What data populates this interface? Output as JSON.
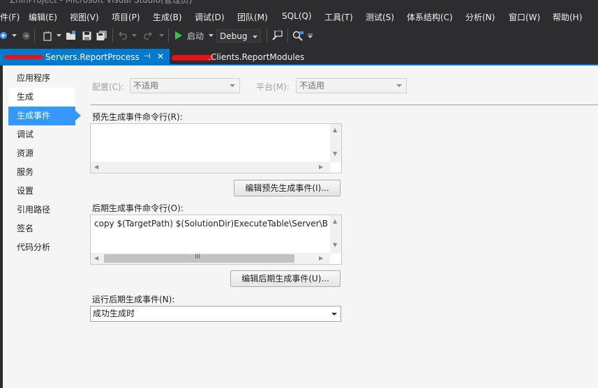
{
  "window": {
    "title": "ZhihProject - Microsoft Visual Studio(管理员)"
  },
  "menu": [
    "件(F)",
    "编辑(E)",
    "视图(V)",
    "项目(P)",
    "生成(B)",
    "调试(D)",
    "团队(M)",
    "SQL(Q)",
    "工具(T)",
    "测试(S)",
    "体系结构(C)",
    "分析(N)",
    "窗口(W)",
    "帮助(H)"
  ],
  "toolbar": {
    "start_label": "启动",
    "config_value": "Debug"
  },
  "tabs": {
    "active": {
      "label": "Servers.ReportProcess",
      "pin_glyph": "⊣",
      "close_glyph": "✕"
    },
    "inactive": {
      "label": ".Clients.ReportModules"
    }
  },
  "nav": [
    "应用程序",
    "生成",
    "生成事件",
    "调试",
    "资源",
    "服务",
    "设置",
    "引用路径",
    "签名",
    "代码分析"
  ],
  "config": {
    "label": "配置(C):",
    "value": "不适用"
  },
  "platform": {
    "label": "平台(M):",
    "value": "不适用"
  },
  "prebuild": {
    "label": "预先生成事件命令行(R):",
    "text": "",
    "edit_button": "编辑预先生成事件(I)..."
  },
  "postbuild": {
    "label": "后期生成事件命令行(O):",
    "text": "copy $(TargetPath) $(SolutionDir)ExecuteTable\\Server\\Bu",
    "edit_button": "编辑后期生成事件(U)...",
    "scroll_grip": "III"
  },
  "run_postbuild": {
    "label": "运行后期生成事件(N):",
    "value": "成功生成时"
  },
  "colors": {
    "accent": "#007acc",
    "selection": "#3399ff",
    "redaction": "#e8131a"
  }
}
